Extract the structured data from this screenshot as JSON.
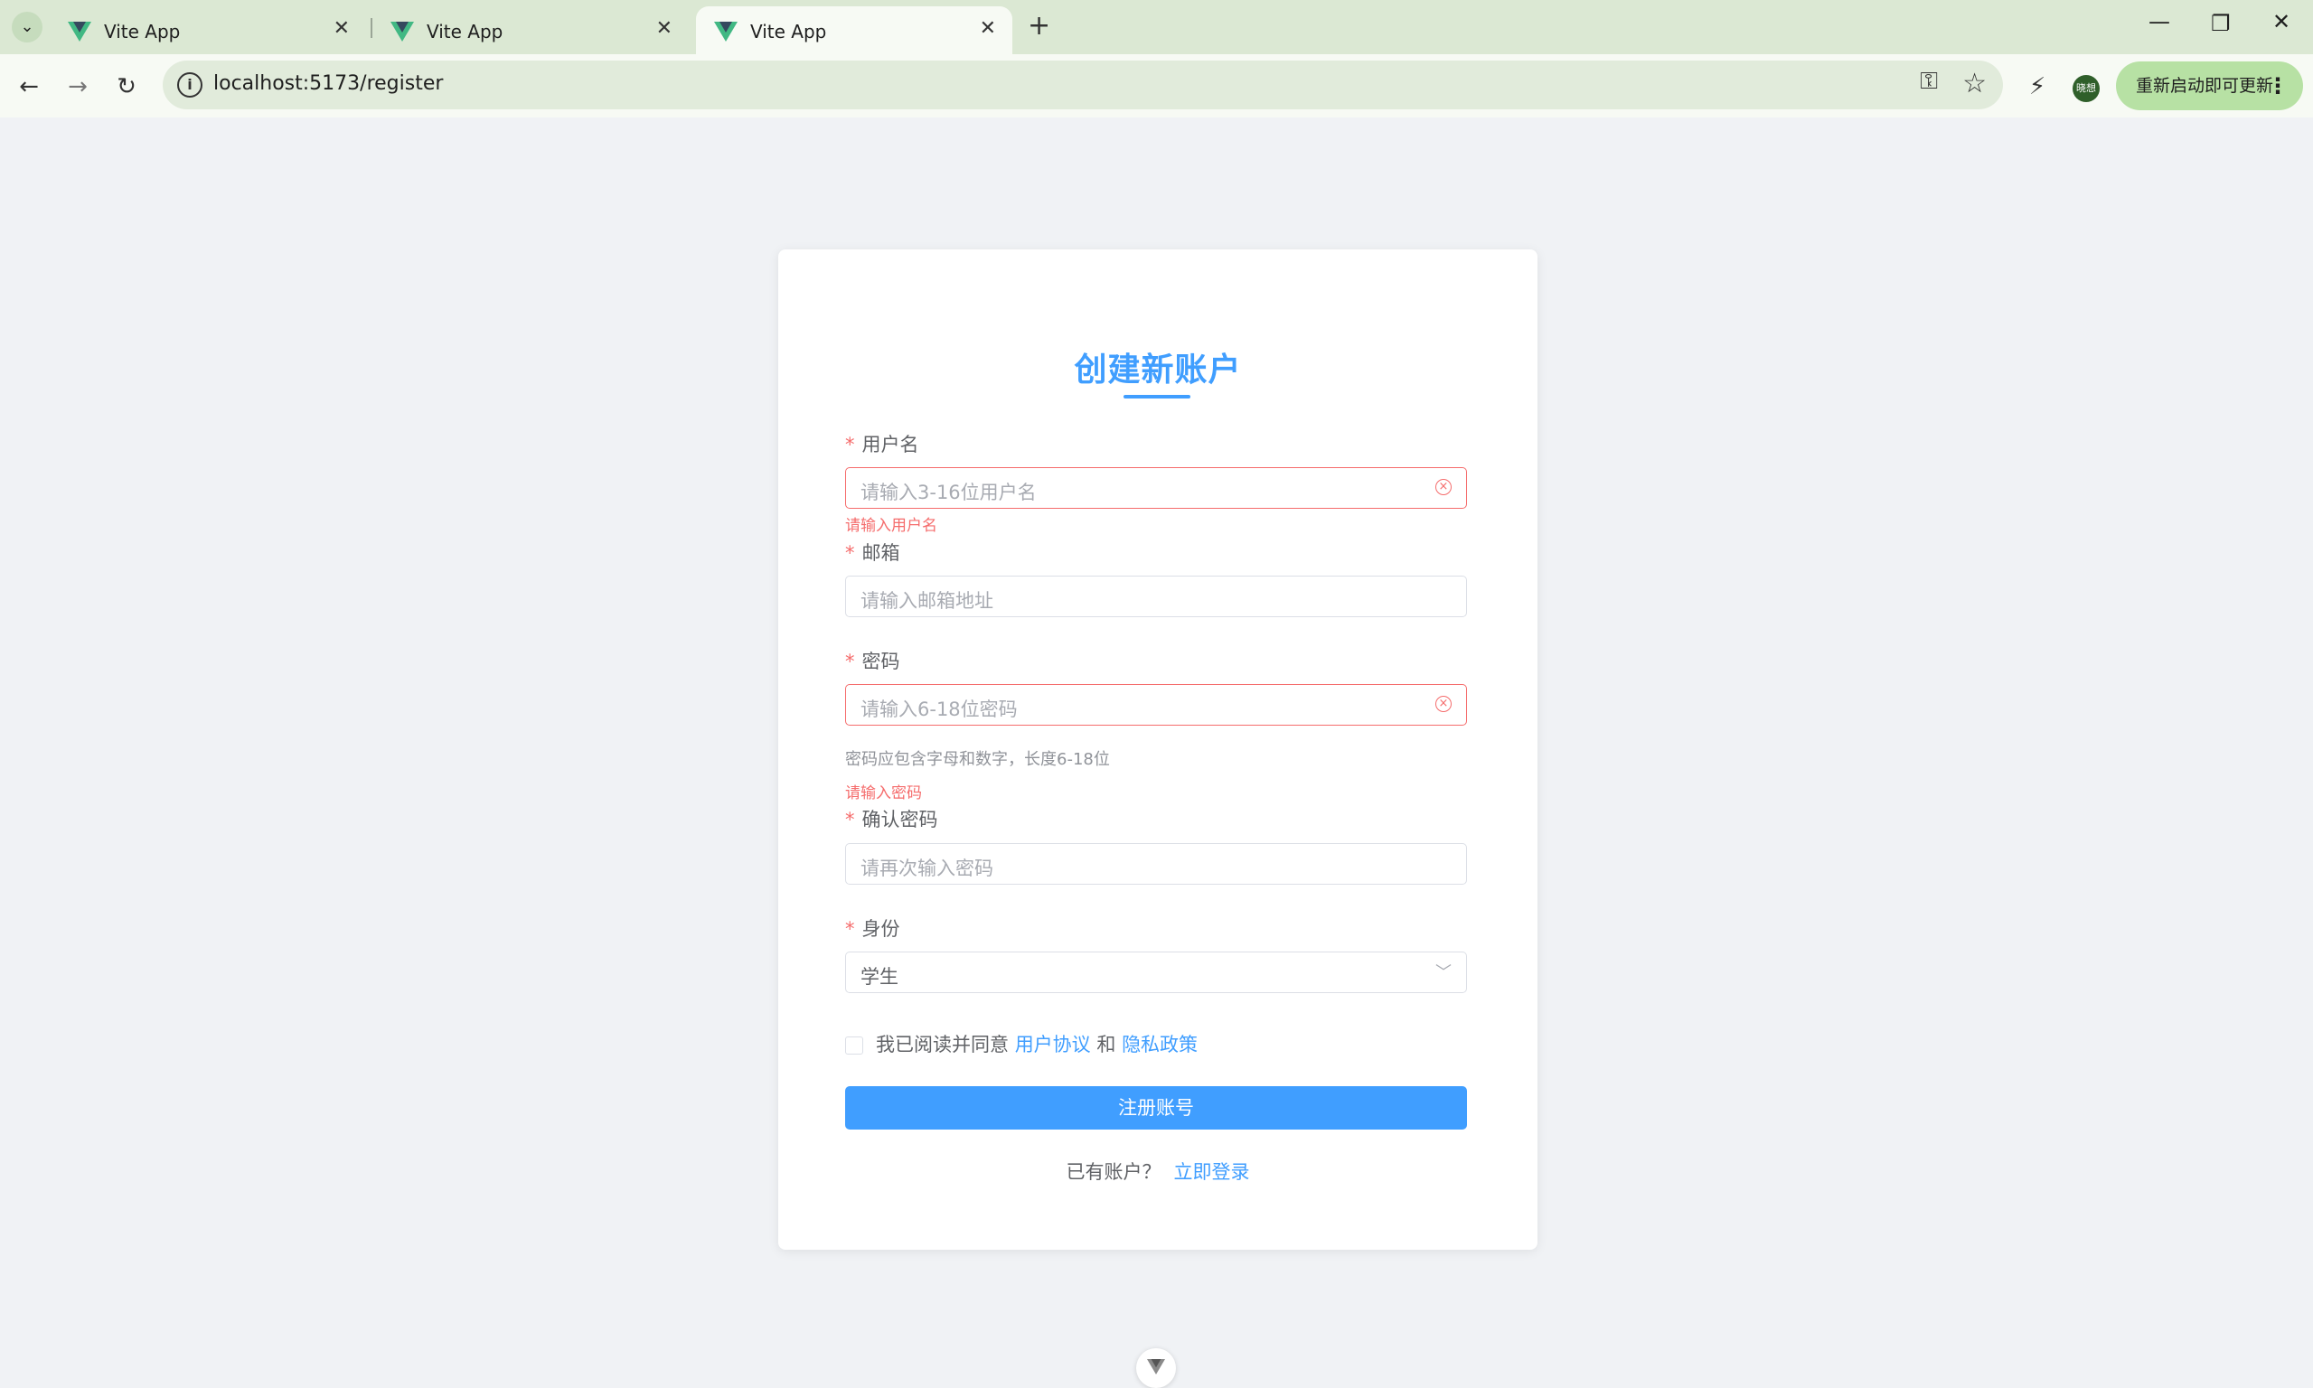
{
  "browser": {
    "tabs": [
      {
        "title": "Vite App",
        "active": false
      },
      {
        "title": "Vite App",
        "active": false
      },
      {
        "title": "Vite App",
        "active": true
      }
    ],
    "url": "localhost:5173/register",
    "profile_avatar": "晓想",
    "update_button": "重新启动即可更新",
    "icons": [
      "tab-search-icon",
      "vue-logo-icon",
      "close-icon",
      "new-tab-icon",
      "minimize-icon",
      "restore-icon",
      "window-close-icon",
      "back-icon",
      "forward-icon",
      "reload-icon",
      "site-info-icon",
      "password-key-icon",
      "bookmark-star-icon",
      "performance-icon",
      "more-menu-icon"
    ]
  },
  "form": {
    "title": "创建新账户",
    "required_mark": "*",
    "username": {
      "label": "用户名",
      "placeholder": "请输入3-16位用户名",
      "error": "请输入用户名"
    },
    "email": {
      "label": "邮箱",
      "placeholder": "请输入邮箱地址"
    },
    "password": {
      "label": "密码",
      "placeholder": "请输入6-18位密码",
      "hint": "密码应包含字母和数字，长度6-18位",
      "error": "请输入密码"
    },
    "confirm_password": {
      "label": "确认密码",
      "placeholder": "请再次输入密码"
    },
    "role": {
      "label": "身份",
      "selected": "学生"
    },
    "agreement": {
      "prefix": "我已阅读并同意",
      "terms_link": "用户协议",
      "and": "和",
      "privacy_link": "隐私政策"
    },
    "submit_label": "注册账号",
    "login_prompt": "已有账户？",
    "login_link": "立即登录"
  },
  "colors": {
    "primary": "#409eff",
    "error": "#f56c6c",
    "background": "#f0f2f5",
    "chrome_tab_bar": "#dbe8d3"
  }
}
